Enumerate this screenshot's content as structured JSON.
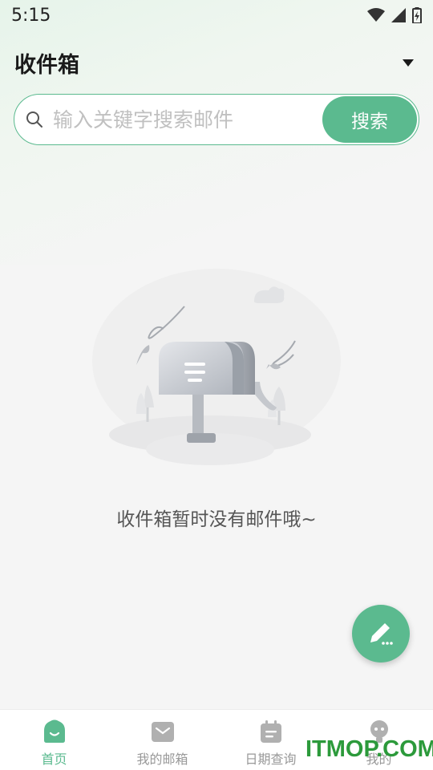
{
  "status_bar": {
    "time": "5:15"
  },
  "header": {
    "title": "收件箱",
    "dropdown_icon": "caret-down-icon"
  },
  "search": {
    "placeholder": "输入关键字搜索邮件",
    "button_label": "搜索",
    "icon": "search-icon"
  },
  "empty_state": {
    "message": "收件箱暂时没有邮件哦~",
    "illustration": "mailbox-illustration"
  },
  "fab": {
    "icon": "edit-pencil-icon"
  },
  "bottom_nav": {
    "items": [
      {
        "label": "首页",
        "icon": "home-icon",
        "active": true
      },
      {
        "label": "我的邮箱",
        "icon": "mailbox-icon",
        "active": false
      },
      {
        "label": "日期查询",
        "icon": "calendar-icon",
        "active": false
      },
      {
        "label": "我的",
        "icon": "profile-icon",
        "active": false
      }
    ]
  },
  "watermark": "ITMOP.COM",
  "colors": {
    "accent": "#5bba8f",
    "inactive": "#999999",
    "watermark": "#2c9a3b"
  }
}
